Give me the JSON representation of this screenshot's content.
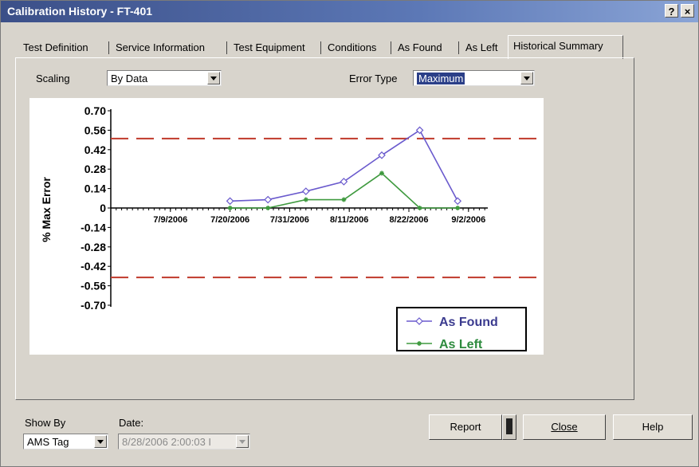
{
  "window": {
    "title": "Calibration History - FT-401",
    "help_btn": "?",
    "close_btn": "×"
  },
  "tabs": [
    {
      "label": "Test Definition"
    },
    {
      "label": "Service Information"
    },
    {
      "label": "Test Equipment"
    },
    {
      "label": "Conditions"
    },
    {
      "label": "As Found"
    },
    {
      "label": "As Left"
    },
    {
      "label": "Historical Summary",
      "active": true
    }
  ],
  "controls": {
    "scaling_label": "Scaling",
    "scaling_value": "By Data",
    "error_type_label": "Error Type",
    "error_type_value": "Maximum"
  },
  "chart_data": {
    "type": "line",
    "ylabel": "% Max Error",
    "xlabel": "",
    "ylim": [
      -0.7,
      0.7
    ],
    "yticks": [
      "0.70",
      "0.56",
      "0.42",
      "0.28",
      "0.14",
      "0",
      "-0.14",
      "-0.28",
      "-0.42",
      "-0.56",
      "-0.70"
    ],
    "xticks": [
      "7/9/2006",
      "7/20/2006",
      "7/31/2006",
      "8/11/2006",
      "8/22/2006",
      "9/2/2006"
    ],
    "limit_lines": [
      0.5,
      -0.5
    ],
    "series": [
      {
        "name": "As Found",
        "color": "#6a5acd",
        "marker": "diamond",
        "x": [
          "7/20/2006",
          "7/27/2006",
          "8/3/2006",
          "8/10/2006",
          "8/17/2006",
          "8/24/2006",
          "8/31/2006"
        ],
        "values": [
          0.05,
          0.06,
          0.12,
          0.19,
          0.38,
          0.56,
          0.05
        ]
      },
      {
        "name": "As Left",
        "color": "#3f9a3f",
        "marker": "asterisk",
        "x": [
          "7/20/2006",
          "7/27/2006",
          "8/3/2006",
          "8/10/2006",
          "8/17/2006",
          "8/24/2006",
          "8/31/2006"
        ],
        "values": [
          0.0,
          0.0,
          0.06,
          0.06,
          0.25,
          0.0,
          0.0
        ]
      }
    ],
    "legend_position": "bottom-right"
  },
  "footer": {
    "show_by_label": "Show By",
    "show_by_value": "AMS Tag",
    "date_label": "Date:",
    "date_value": "8/28/2006 2:00:03 I",
    "report_label": "Report",
    "close_label": "Close",
    "help_label": "Help"
  }
}
